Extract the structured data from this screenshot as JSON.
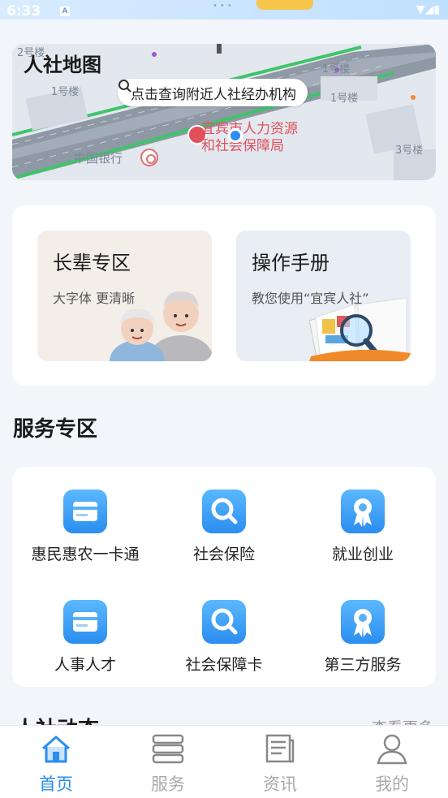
{
  "status": {
    "time": "6:33",
    "indicator": "A"
  },
  "map": {
    "title": "人社地图",
    "search_text": "点击查询附近人社经办机构",
    "poi_line1": "宜宾市人力资源",
    "poi_line2": "和社会保障局",
    "bank": "中国银行",
    "building_labels": [
      "2号楼",
      "1号楼",
      "1号楼",
      "1号楼",
      "3号楼"
    ]
  },
  "shortcuts": {
    "elder": {
      "title": "长辈专区",
      "subtitle": "大字体 更清晰"
    },
    "manual": {
      "title": "操作手册",
      "subtitle": "教您使用“宜宾人社”"
    }
  },
  "services": {
    "section_title": "服务专区",
    "items": [
      {
        "label": "惠民惠农一卡通",
        "icon": "card-icon"
      },
      {
        "label": "社会保险",
        "icon": "search-icon"
      },
      {
        "label": "就业创业",
        "icon": "award-icon"
      },
      {
        "label": "人事人才",
        "icon": "card-icon"
      },
      {
        "label": "社会保障卡",
        "icon": "search-icon"
      },
      {
        "label": "第三方服务",
        "icon": "award-icon"
      }
    ]
  },
  "news": {
    "title": "人社动态",
    "more": "查看更多"
  },
  "tabbar": {
    "items": [
      {
        "label": "首页",
        "icon": "home-icon",
        "active": true
      },
      {
        "label": "服务",
        "icon": "stack-icon",
        "active": false
      },
      {
        "label": "资讯",
        "icon": "news-icon",
        "active": false
      },
      {
        "label": "我的",
        "icon": "user-icon",
        "active": false
      }
    ]
  },
  "colors": {
    "accent": "#2a8cf0",
    "poi": "#e0505a",
    "page_bg": "#f2f5f9"
  }
}
